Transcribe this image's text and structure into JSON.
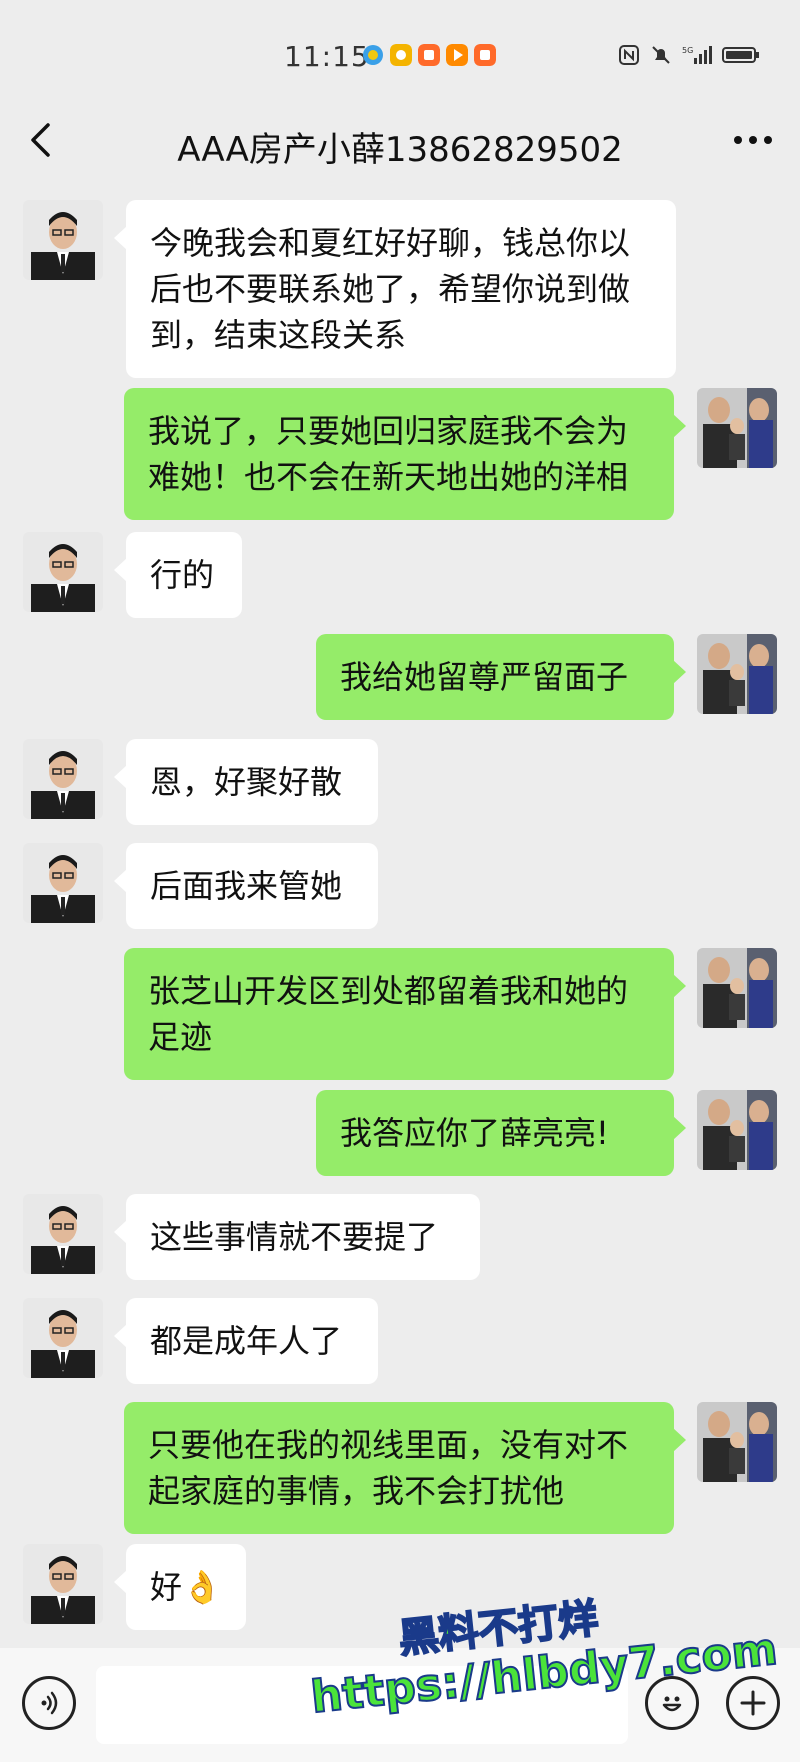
{
  "status_bar": {
    "time": "11:15",
    "network": "5G"
  },
  "header": {
    "title": "AAA房产小薛13862829502"
  },
  "messages": [
    {
      "from": "contact",
      "text": "今晚我会和夏红好好聊，钱总你以后也不要联系她了，希望你说到做到，结束这段关系"
    },
    {
      "from": "me",
      "text": "我说了，只要她回归家庭我不会为难她！也不会在新天地出她的洋相"
    },
    {
      "from": "contact",
      "text": "行的"
    },
    {
      "from": "me",
      "text": "我给她留尊严留面子"
    },
    {
      "from": "contact",
      "text": "恩，好聚好散"
    },
    {
      "from": "contact",
      "text": "后面我来管她"
    },
    {
      "from": "me",
      "text": "张芝山开发区到处都留着我和她的足迹"
    },
    {
      "from": "me",
      "text": "我答应你了薛亮亮!"
    },
    {
      "from": "contact",
      "text": "这些事情就不要提了"
    },
    {
      "from": "contact",
      "text": "都是成年人了"
    },
    {
      "from": "me",
      "text": "只要他在我的视线里面，没有对不起家庭的事情，我不会打扰他"
    },
    {
      "from": "contact",
      "text": "好👌"
    }
  ],
  "watermark": {
    "line1": "黑料不打烊",
    "line2": "https://hlbdy7.com"
  },
  "colors": {
    "background": "#ededed",
    "incoming_bubble": "#ffffff",
    "outgoing_bubble": "#95ec69",
    "watermark": "#4be33a"
  },
  "icons": {
    "back": "chevron-left-icon",
    "more": "more-dots-icon",
    "voice": "voice-icon",
    "emoji": "emoji-icon",
    "plus": "plus-icon"
  }
}
